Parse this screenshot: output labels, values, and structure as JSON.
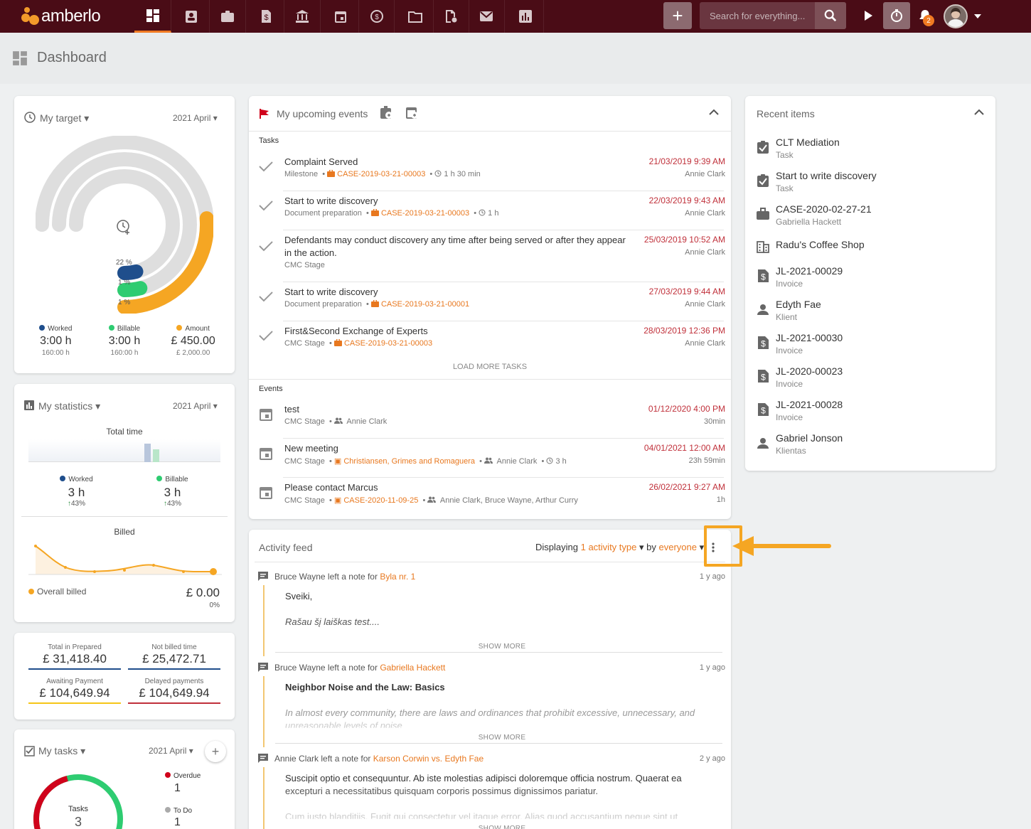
{
  "app": {
    "name": "amberlo"
  },
  "topbar": {
    "search_placeholder": "Search for everything...",
    "notification_count": "2",
    "plus_label": "+"
  },
  "page": {
    "title": "Dashboard"
  },
  "target": {
    "title": "My target",
    "period": "2021 April",
    "rings": [
      {
        "label": "22 %",
        "fraction": 0.22
      },
      {
        "label": "1 %",
        "fraction": 0.01
      },
      {
        "label": "1 %",
        "fraction": 0.01
      }
    ],
    "legend": [
      {
        "name": "Worked",
        "value": "3:00 h",
        "target": "160:00 h",
        "color": "#1f4e8c"
      },
      {
        "name": "Billable",
        "value": "3:00 h",
        "target": "160:00 h",
        "color": "#2ecc71"
      },
      {
        "name": "Amount",
        "value": "£ 450.00",
        "target": "£ 2,000.00",
        "color": "#f5a623"
      }
    ]
  },
  "statistics": {
    "title": "My statistics",
    "period": "2021 April",
    "total_time_label": "Total time",
    "worked": {
      "label": "Worked",
      "value": "3 h",
      "change": "43%"
    },
    "billable": {
      "label": "Billable",
      "value": "3 h",
      "change": "43%"
    },
    "billed_label": "Billed",
    "overall_billed_label": "Overall billed",
    "overall_billed_value": "£ 0.00",
    "overall_billed_pct": "0%"
  },
  "totals": [
    {
      "label": "Total in Prepared",
      "value": "£ 31,418.40",
      "color": "#1f4e8c"
    },
    {
      "label": "Not billed time",
      "value": "£ 25,472.71",
      "color": "#1f4e8c"
    },
    {
      "label": "Awaiting Payment",
      "value": "£ 104,649.94",
      "color": "#f5c518"
    },
    {
      "label": "Delayed payments",
      "value": "£ 104,649.94",
      "color": "#c0303a"
    }
  ],
  "my_tasks": {
    "title": "My tasks",
    "period": "2021 April",
    "center_label": "Tasks",
    "center_value": "3",
    "overdue": {
      "label": "Overdue",
      "value": "1"
    },
    "todo": {
      "label": "To Do",
      "value": "1"
    }
  },
  "upcoming": {
    "title": "My upcoming events",
    "tasks_label": "Tasks",
    "tasks": [
      {
        "title": "Complaint Served",
        "type": "Milestone",
        "case": "CASE-2019-03-21-00003",
        "duration": "1 h 30 min",
        "date": "21/03/2019 9:39 AM",
        "assignee": "Annie Clark"
      },
      {
        "title": "Start to write discovery",
        "type": "Document preparation",
        "case": "CASE-2019-03-21-00003",
        "duration": "1 h",
        "date": "22/03/2019 9:43 AM",
        "assignee": "Annie Clark"
      },
      {
        "title": "Defendants may conduct discovery any time after being served or after they appear",
        "title2": "in the action.",
        "type": "CMC Stage",
        "case": "",
        "duration": "",
        "date": "25/03/2019 10:52 AM",
        "assignee": "Annie Clark"
      },
      {
        "title": "Start to write discovery",
        "type": "Document preparation",
        "case": "CASE-2019-03-21-00001",
        "duration": "",
        "date": "27/03/2019 9:44 AM",
        "assignee": "Annie Clark"
      },
      {
        "title": "First&Second Exchange of Experts",
        "type": "CMC Stage",
        "case": "CASE-2019-03-21-00003",
        "duration": "",
        "date": "28/03/2019 12:36 PM",
        "assignee": "Annie Clark"
      }
    ],
    "load_more": "LOAD MORE TASKS",
    "events_label": "Events",
    "events": [
      {
        "title": "test",
        "type": "CMC Stage",
        "link": "",
        "people": "Annie Clark",
        "duration": "",
        "date": "01/12/2020 4:00 PM",
        "length": "30min"
      },
      {
        "title": "New meeting",
        "type": "CMC Stage",
        "link": "Christiansen, Grimes and Romaguera",
        "people": "Annie Clark",
        "duration": "3 h",
        "date": "04/01/2021 12:00 AM",
        "length": "23h 59min"
      },
      {
        "title": "Please contact Marcus",
        "type": "CMC Stage",
        "link": "CASE-2020-11-09-25",
        "people": "Annie Clark, Bruce Wayne, Arthur Curry",
        "duration": "",
        "date": "26/02/2021 9:27 AM",
        "length": "1h"
      }
    ]
  },
  "recent": {
    "title": "Recent items",
    "items": [
      {
        "title": "CLT Mediation",
        "sub": "Task",
        "icon": "task-icon"
      },
      {
        "title": "Start to write discovery",
        "sub": "Task",
        "icon": "task-icon"
      },
      {
        "title": "CASE-2020-02-27-21",
        "sub": "Gabriella Hackett",
        "icon": "briefcase-icon"
      },
      {
        "title": "Radu's Coffee Shop",
        "sub": "",
        "icon": "building-icon"
      },
      {
        "title": "JL-2021-00029",
        "sub": "Invoice",
        "icon": "invoice-icon"
      },
      {
        "title": "Edyth Fae",
        "sub": "Klient",
        "icon": "person-icon"
      },
      {
        "title": "JL-2021-00030",
        "sub": "Invoice",
        "icon": "invoice-icon"
      },
      {
        "title": "JL-2020-00023",
        "sub": "Invoice",
        "icon": "invoice-icon"
      },
      {
        "title": "JL-2021-00028",
        "sub": "Invoice",
        "icon": "invoice-icon"
      },
      {
        "title": "Gabriel Jonson",
        "sub": "Klientas",
        "icon": "person-icon"
      }
    ]
  },
  "feed": {
    "title": "Activity feed",
    "displaying": "Displaying",
    "activity_type": "1 activity type",
    "by": "by",
    "everyone": "everyone",
    "items": [
      {
        "author": "Bruce Wayne left a note for",
        "target": "Byla nr. 1",
        "time": "1 y ago",
        "line1": "Sveiki,",
        "line2": "Rašau šį laiškas test....",
        "show_more": "SHOW MORE"
      },
      {
        "author": "Bruce Wayne left a note for",
        "target": "Gabriella Hackett",
        "time": "1 y ago",
        "line1": "Neighbor Noise and the Law: Basics",
        "line2": "In almost every community, there are laws and ordinances that prohibit excessive, unnecessary, and",
        "line3": "unreasonable levels of noise",
        "show_more": "SHOW MORE"
      },
      {
        "author": "Annie Clark left a note for",
        "target": "Karson Corwin vs. Edyth Fae",
        "time": "2 y ago",
        "line1": "Suscipit optio et consequuntur. Ab iste molestias adipisci doloremque officia nostrum. Quaerat ea",
        "line2": "excepturi a necessitatibus quisquam corporis possimus dignissimos pariatur.",
        "line3": "Cum iusto blanditiis. Fugit qui consectetur vel itaque error. Alias quod accusantium neque sint ut",
        "show_more": "SHOW MORE"
      }
    ]
  },
  "colors": {
    "accent": "#e8781f",
    "topbar": "#4a0c16",
    "highlight": "#f5a623"
  }
}
